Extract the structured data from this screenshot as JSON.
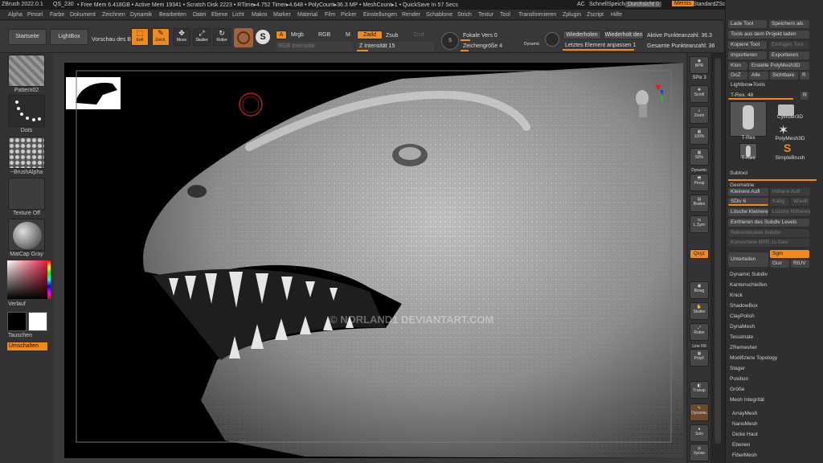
{
  "titlebar": {
    "app": "ZBrush 2022.0.1",
    "qs": "QS_230",
    "stats": "• Free Mem 6.418GB • Active Mem 19341 • Scratch Disk 2223 • RTime▸4.752 Timer▸4.648 • PolyCount▸36.3 MP • MeshCount▸1 • QuickSave In 57 Secs",
    "ac": "AC",
    "quicksave": "SchnellSpeiche",
    "transparency": "Durchsicht 0",
    "menu_btn": "Menüs",
    "script": "StandardZScrip"
  },
  "menu": [
    "Alpha",
    "Pinsel",
    "Farbe",
    "Dokument",
    "Zeichnen",
    "Dynamik",
    "Bearbeiten",
    "Datei",
    "Ebene",
    "Licht",
    "Makro",
    "Marker",
    "Material",
    "Film",
    "Picker",
    "Einstellungen",
    "Render",
    "Schablone",
    "Strich",
    "Textur",
    "Tool",
    "Transformieren",
    "Zplugin",
    "Zscript",
    "Hilfe"
  ],
  "toolbar": {
    "home": "Startseite",
    "lightbox": "LightBox",
    "preview": "Vorschau des Bi",
    "edit": "Edit",
    "draw": "Zeich.",
    "move": "Move",
    "scale": "Skalier",
    "rotate": "Rotier",
    "a_btn": "A",
    "mrgb": "Mrgb",
    "rgb": "RGB",
    "m": "M",
    "zadd": "Zadd",
    "zsub": "Zsub",
    "zcut": "Zcut",
    "rgb_intensity": "RGB Intensität",
    "z_intensity": "Z Intensität 15",
    "focal_shift": "Fokale Vers 0",
    "draw_size": "Zeichengröße 4",
    "dynamic": "Dynamic",
    "redo": "Wiederholen",
    "redo_at": "Wiederholt den",
    "adjust_last": "Letztes Element anpassen 1",
    "active_points": "Aktive Punkteanzahl: 36.3",
    "total_points": "Gesamte Punkteanzahl: 36"
  },
  "left": {
    "pattern": "Pattern02",
    "dots": "Dots",
    "brushalpha": "~BrushAlpha",
    "texture": "Texture Off",
    "matcap": "MatCap Gray",
    "gradient": "Verlauf",
    "swap": "Tauschen",
    "switch": "Umschalten"
  },
  "canvas": {
    "watermark": "© NORLAND1 DEVIANTART.COM"
  },
  "right": {
    "bpr": "BPR",
    "spix": "SPix 3",
    "scroll": "Scroll",
    "zoom": "Zoom",
    "ac100": "100%",
    "ac50": "50%",
    "dynamic": "Dynamic",
    "persp": "Persp",
    "floor": "Boden",
    "lsym": "L.Sym",
    "xyz": "Qxyz",
    "move": "Bewg",
    "scale": "Skalier",
    "rotate": "Rotier",
    "linefill": "Line Fill",
    "polyf": "PolyF",
    "transp": "Transp",
    "dynamic2": "Dynamic",
    "solo": "Solo",
    "xpose": "Xpose"
  },
  "tray": {
    "load_tool": "Lade Tool",
    "save_as": "Speichern als",
    "tools_from_project": "Tools aus dem Projekt laden",
    "copy_tool": "Kopiere Tool",
    "paste_tool": "Einfügen Tool",
    "import": "Importieren",
    "export": "Exportieren",
    "clone": "Klon",
    "make_polymesh": "Erstelle PolyMesh3D",
    "goz": "GoZ",
    "all": "Alle",
    "visible": "Sichtbare",
    "r": "R",
    "lightbox_tools": "Lightbox▸Tools",
    "trex_slider": "T-Rex. 48",
    "tools": [
      {
        "label": "T-Rex"
      },
      {
        "label": "Cylinder3D"
      },
      {
        "label": "PolyMesh3D"
      },
      {
        "label": "T-Rex"
      },
      {
        "label": "SimpleBrush"
      }
    ],
    "subtool": "Subtool",
    "geometry": "Geometrie",
    "lower_res": "Kleinere Aufl",
    "higher_res": "Höhere Aufl",
    "sdiv": "SDiv 6",
    "cage": "Käfig",
    "rstr": "Wiedh",
    "del_lower": "Lösche Kleinere",
    "del_higher": "Lösche Höheres",
    "freeze_subdiv": "Einfrieren des Subdiv Levels",
    "reconstruct": "Rekonstruiere Subdiv",
    "convert_bpr": "Konvertiere BPR zu Geo",
    "divide": "Unterteilen",
    "smt": "Sgm",
    "suv": "Guv",
    "reuv": "RtUV",
    "sections": [
      "Dynamic Subdiv",
      "Kantenschleifen",
      "Knick",
      "ShadowBox",
      "ClayPolish",
      "DynaMesh",
      "Tessimate",
      "ZRemesher",
      "Modifiziere Topology",
      "Stager",
      "Position",
      "Größe",
      "Mesh Integrität"
    ],
    "subpalettes": [
      "ArrayMesh",
      "NanoMesh",
      "Dicke Haut",
      "Ebenen",
      "FiberMesh"
    ]
  },
  "colors": {
    "accent": "#f08a1c",
    "primary_color": "#000000",
    "secondary_color": "#ffffff"
  }
}
